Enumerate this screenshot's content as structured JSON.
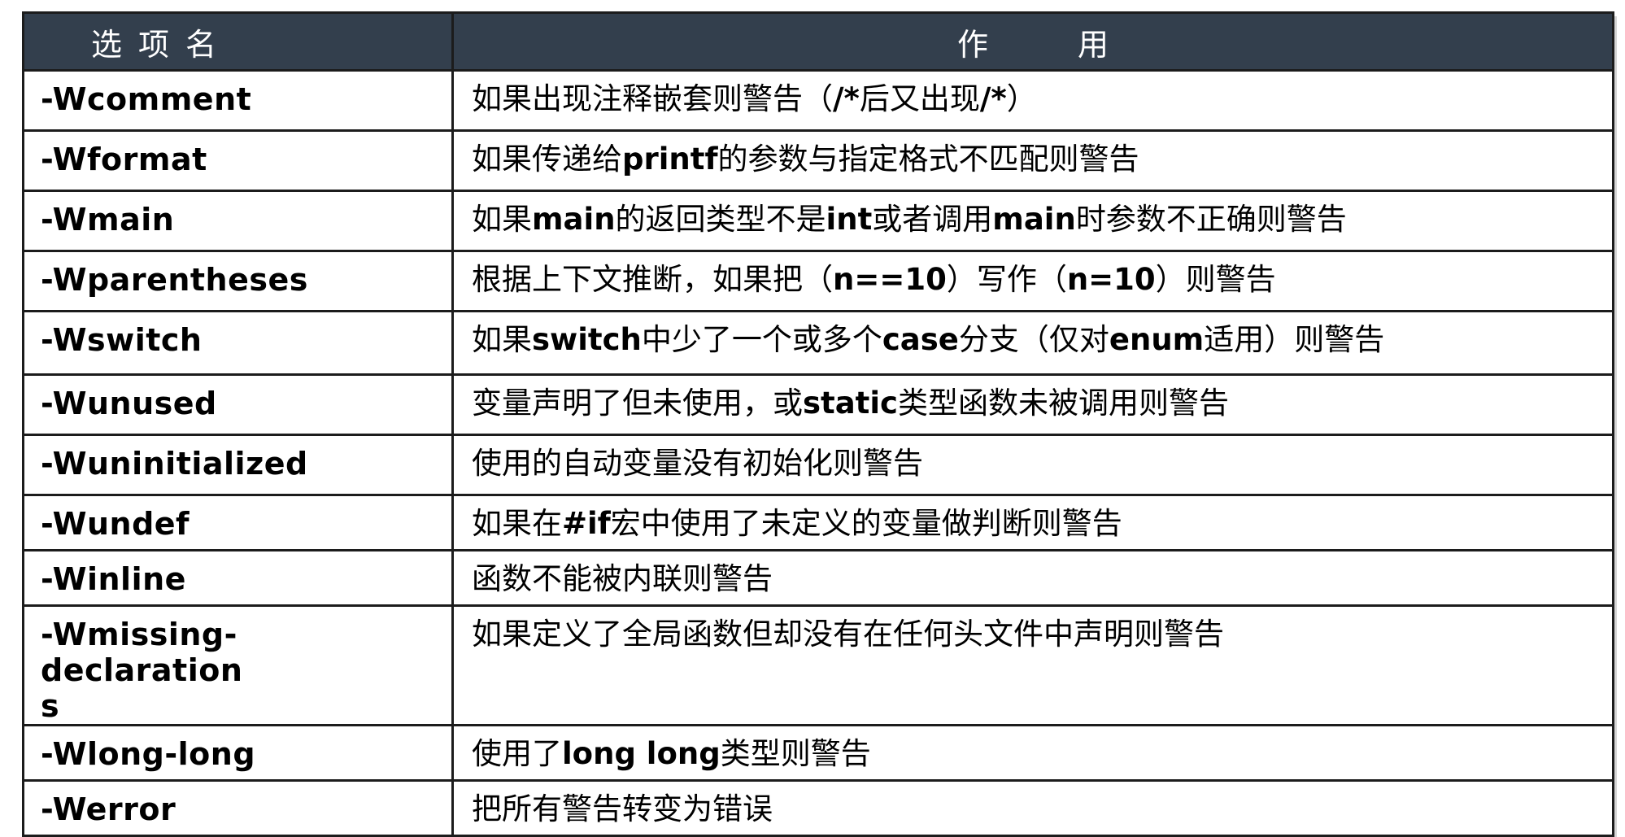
{
  "table": {
    "headers": [
      "选项名",
      "作用"
    ],
    "rows": [
      {
        "option": "-Wcomment",
        "effect": "如果出现注释嵌套则警告（/*后又出现/*）"
      },
      {
        "option": "-Wformat",
        "effect": "如果传递给printf的参数与指定格式不匹配则警告"
      },
      {
        "option": "-Wmain",
        "effect": "如果main的返回类型不是int或者调用main时参数不正确则警告"
      },
      {
        "option": "-Wparentheses",
        "effect": "根据上下文推断，如果把（n==10）写作（n=10）则警告"
      },
      {
        "option": "-Wswitch",
        "effect": "如果switch中少了一个或多个case分支（仅对enum适用）则警告"
      },
      {
        "option": "-Wunused",
        "effect": "变量声明了但未使用，或static类型函数未被调用则警告"
      },
      {
        "option": "-Wuninitialized",
        "effect": "使用的自动变量没有初始化则警告"
      },
      {
        "option": "-Wundef",
        "effect": "如果在#if宏中使用了未定义的变量做判断则警告"
      },
      {
        "option": "-Winline",
        "effect": "函数不能被内联则警告"
      },
      {
        "option": "-Wmissing-declarations",
        "effect": "如果定义了全局函数但却没有在任何头文件中声明则警告"
      },
      {
        "option": "-Wlong-long",
        "effect": "使用了long long类型则警告"
      },
      {
        "option": "-Werror",
        "effect": "把所有警告转变为错误"
      }
    ]
  },
  "colors": {
    "header_bg": "#333f4d",
    "header_text": "#ffffff",
    "border": "#1c1c1c"
  }
}
